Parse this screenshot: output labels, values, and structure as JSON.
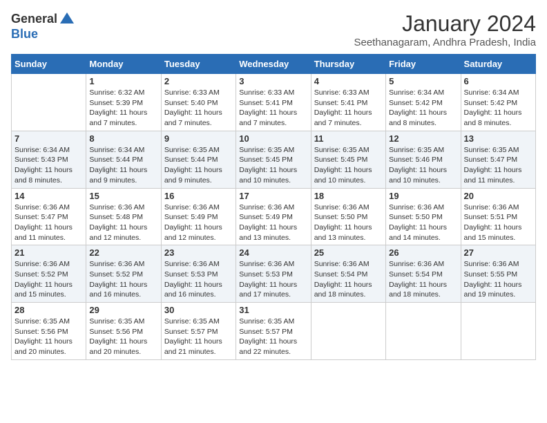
{
  "logo": {
    "general": "General",
    "blue": "Blue"
  },
  "title": "January 2024",
  "location": "Seethanagaram, Andhra Pradesh, India",
  "days_of_week": [
    "Sunday",
    "Monday",
    "Tuesday",
    "Wednesday",
    "Thursday",
    "Friday",
    "Saturday"
  ],
  "weeks": [
    [
      {
        "day": "",
        "info": ""
      },
      {
        "day": "1",
        "info": "Sunrise: 6:32 AM\nSunset: 5:39 PM\nDaylight: 11 hours\nand 7 minutes."
      },
      {
        "day": "2",
        "info": "Sunrise: 6:33 AM\nSunset: 5:40 PM\nDaylight: 11 hours\nand 7 minutes."
      },
      {
        "day": "3",
        "info": "Sunrise: 6:33 AM\nSunset: 5:41 PM\nDaylight: 11 hours\nand 7 minutes."
      },
      {
        "day": "4",
        "info": "Sunrise: 6:33 AM\nSunset: 5:41 PM\nDaylight: 11 hours\nand 7 minutes."
      },
      {
        "day": "5",
        "info": "Sunrise: 6:34 AM\nSunset: 5:42 PM\nDaylight: 11 hours\nand 8 minutes."
      },
      {
        "day": "6",
        "info": "Sunrise: 6:34 AM\nSunset: 5:42 PM\nDaylight: 11 hours\nand 8 minutes."
      }
    ],
    [
      {
        "day": "7",
        "info": "Sunrise: 6:34 AM\nSunset: 5:43 PM\nDaylight: 11 hours\nand 8 minutes."
      },
      {
        "day": "8",
        "info": "Sunrise: 6:34 AM\nSunset: 5:44 PM\nDaylight: 11 hours\nand 9 minutes."
      },
      {
        "day": "9",
        "info": "Sunrise: 6:35 AM\nSunset: 5:44 PM\nDaylight: 11 hours\nand 9 minutes."
      },
      {
        "day": "10",
        "info": "Sunrise: 6:35 AM\nSunset: 5:45 PM\nDaylight: 11 hours\nand 10 minutes."
      },
      {
        "day": "11",
        "info": "Sunrise: 6:35 AM\nSunset: 5:45 PM\nDaylight: 11 hours\nand 10 minutes."
      },
      {
        "day": "12",
        "info": "Sunrise: 6:35 AM\nSunset: 5:46 PM\nDaylight: 11 hours\nand 10 minutes."
      },
      {
        "day": "13",
        "info": "Sunrise: 6:35 AM\nSunset: 5:47 PM\nDaylight: 11 hours\nand 11 minutes."
      }
    ],
    [
      {
        "day": "14",
        "info": "Sunrise: 6:36 AM\nSunset: 5:47 PM\nDaylight: 11 hours\nand 11 minutes."
      },
      {
        "day": "15",
        "info": "Sunrise: 6:36 AM\nSunset: 5:48 PM\nDaylight: 11 hours\nand 12 minutes."
      },
      {
        "day": "16",
        "info": "Sunrise: 6:36 AM\nSunset: 5:49 PM\nDaylight: 11 hours\nand 12 minutes."
      },
      {
        "day": "17",
        "info": "Sunrise: 6:36 AM\nSunset: 5:49 PM\nDaylight: 11 hours\nand 13 minutes."
      },
      {
        "day": "18",
        "info": "Sunrise: 6:36 AM\nSunset: 5:50 PM\nDaylight: 11 hours\nand 13 minutes."
      },
      {
        "day": "19",
        "info": "Sunrise: 6:36 AM\nSunset: 5:50 PM\nDaylight: 11 hours\nand 14 minutes."
      },
      {
        "day": "20",
        "info": "Sunrise: 6:36 AM\nSunset: 5:51 PM\nDaylight: 11 hours\nand 15 minutes."
      }
    ],
    [
      {
        "day": "21",
        "info": "Sunrise: 6:36 AM\nSunset: 5:52 PM\nDaylight: 11 hours\nand 15 minutes."
      },
      {
        "day": "22",
        "info": "Sunrise: 6:36 AM\nSunset: 5:52 PM\nDaylight: 11 hours\nand 16 minutes."
      },
      {
        "day": "23",
        "info": "Sunrise: 6:36 AM\nSunset: 5:53 PM\nDaylight: 11 hours\nand 16 minutes."
      },
      {
        "day": "24",
        "info": "Sunrise: 6:36 AM\nSunset: 5:53 PM\nDaylight: 11 hours\nand 17 minutes."
      },
      {
        "day": "25",
        "info": "Sunrise: 6:36 AM\nSunset: 5:54 PM\nDaylight: 11 hours\nand 18 minutes."
      },
      {
        "day": "26",
        "info": "Sunrise: 6:36 AM\nSunset: 5:54 PM\nDaylight: 11 hours\nand 18 minutes."
      },
      {
        "day": "27",
        "info": "Sunrise: 6:36 AM\nSunset: 5:55 PM\nDaylight: 11 hours\nand 19 minutes."
      }
    ],
    [
      {
        "day": "28",
        "info": "Sunrise: 6:35 AM\nSunset: 5:56 PM\nDaylight: 11 hours\nand 20 minutes."
      },
      {
        "day": "29",
        "info": "Sunrise: 6:35 AM\nSunset: 5:56 PM\nDaylight: 11 hours\nand 20 minutes."
      },
      {
        "day": "30",
        "info": "Sunrise: 6:35 AM\nSunset: 5:57 PM\nDaylight: 11 hours\nand 21 minutes."
      },
      {
        "day": "31",
        "info": "Sunrise: 6:35 AM\nSunset: 5:57 PM\nDaylight: 11 hours\nand 22 minutes."
      },
      {
        "day": "",
        "info": ""
      },
      {
        "day": "",
        "info": ""
      },
      {
        "day": "",
        "info": ""
      }
    ]
  ]
}
